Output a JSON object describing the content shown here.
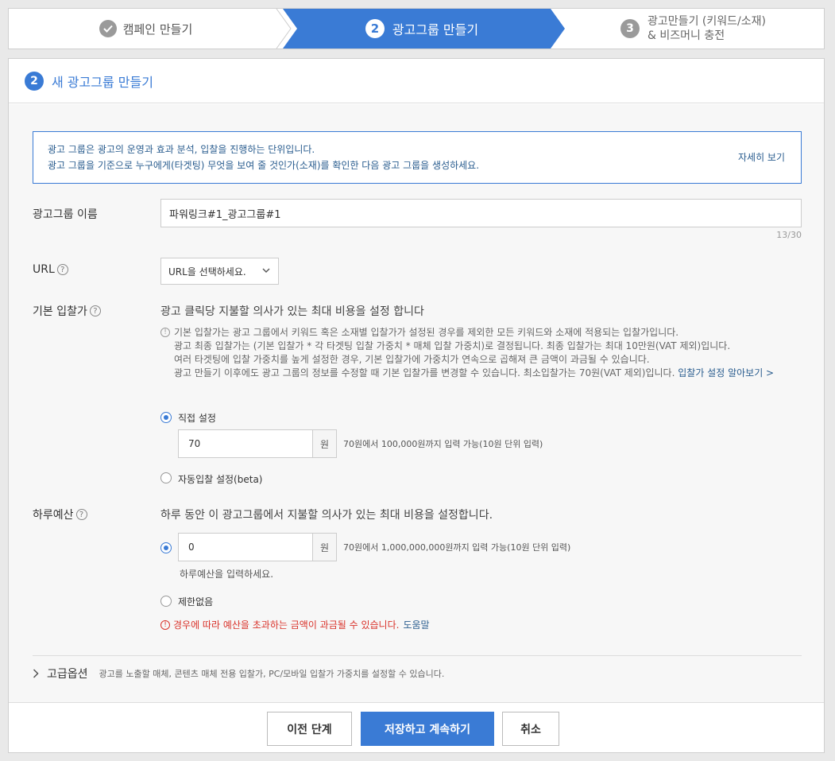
{
  "steps": {
    "step1_label": "캠페인 만들기",
    "step2_num": "2",
    "step2_label": "광고그룹 만들기",
    "step3_num": "3",
    "step3_line1": "광고만들기 (키워드/소재)",
    "step3_line2": "& 비즈머니 충전"
  },
  "header": {
    "num": "2",
    "title": "새 광고그룹 만들기"
  },
  "info": {
    "line1": "광고 그룹은 광고의 운영과 효과 분석, 입찰을 진행하는 단위입니다.",
    "line2": "광고 그룹을 기준으로 누구에게(타겟팅) 무엇을 보여 줄 것인가(소재)를 확인한 다음 광고 그룹을 생성하세요.",
    "more": "자세히 보기"
  },
  "name": {
    "label": "광고그룹 이름",
    "value": "파워링크#1_광고그룹#1",
    "counter": "13/30"
  },
  "url": {
    "label": "URL",
    "select": "URL을 선택하세요."
  },
  "bid": {
    "label": "기본 입찰가",
    "desc": "광고 클릭당 지불할 의사가 있는 최대 비용을 설정 합니다",
    "note1": "기본 입찰가는 광고 그룹에서 키워드 혹은 소재별 입찰가가 설정된 경우를 제외한 모든 키워드와 소재에 적용되는 입찰가입니다.",
    "note2": "광고 최종 입찰가는 (기본 입찰가 * 각 타겟팅 입찰 가중치 * 매체 입찰 가중치)로 결정됩니다. 최종 입찰가는 최대 10만원(VAT 제외)입니다.",
    "note3": "여러 타겟팅에 입찰 가중치를 높게 설정한 경우, 기본 입찰가에 가중치가 연속으로 곱해져 큰 금액이 과금될 수 있습니다.",
    "note4": "광고 만들기 이후에도 광고 그룹의 정보를 수정할 때 기본 입찰가를 변경할 수 있습니다. 최소입찰가는 70원(VAT 제외)입니다.",
    "note_link": "입찰가 설정 알아보기 >",
    "manual_label": "직접 설정",
    "value": "70",
    "unit": "원",
    "hint": "70원에서 100,000원까지 입력 가능(10원 단위 입력)",
    "auto_label": "자동입찰 설정(beta)"
  },
  "budget": {
    "label": "하루예산",
    "desc": "하루 동안 이 광고그룹에서 지불할 의사가 있는 최대 비용을 설정합니다.",
    "value": "0",
    "unit": "원",
    "hint": "70원에서 1,000,000,000원까지 입력 가능(10원 단위 입력)",
    "subhint": "하루예산을 입력하세요.",
    "unlimited_label": "제한없음",
    "warn": "경우에 따라 예산을 초과하는 금액이 과금될 수 있습니다.",
    "help": "도움말"
  },
  "advanced": {
    "title": "고급옵션",
    "desc": "광고를 노출할 매체, 콘텐츠 매체 전용 입찰가, PC/모바일 입찰가 가중치를 설정할 수 있습니다."
  },
  "footer": {
    "prev": "이전 단계",
    "save": "저장하고 계속하기",
    "cancel": "취소"
  },
  "colors": {
    "accent": "#3a7bd5",
    "warn": "#d9332b"
  }
}
